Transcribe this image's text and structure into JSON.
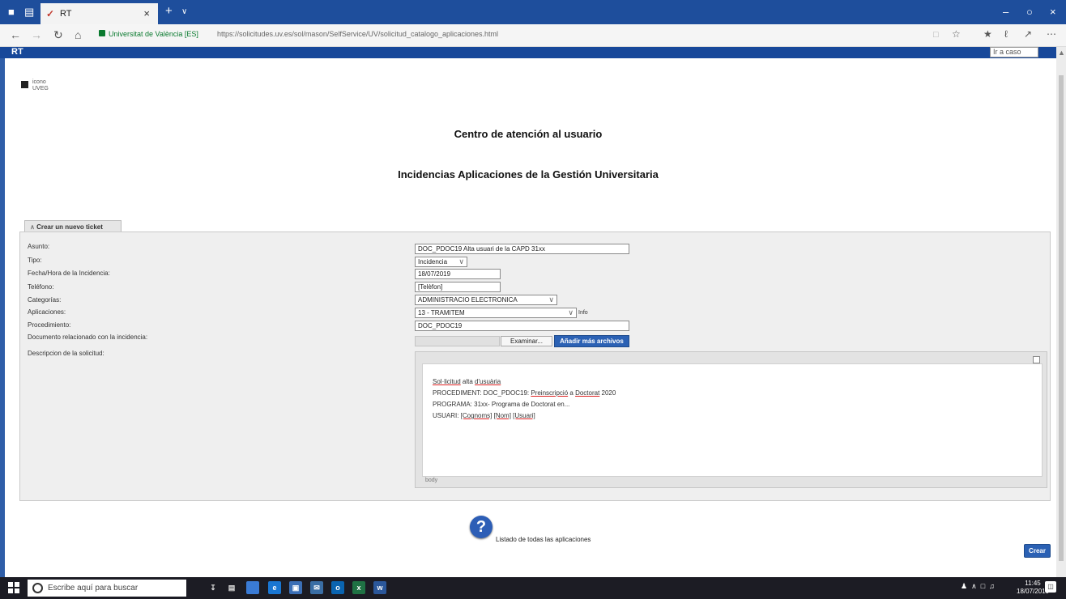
{
  "browser": {
    "tab_title": "RT",
    "site_identity": "Universitat de València [ES]",
    "url": "https://solicitudes.uv.es/sol/mason/SelfService/UV/solicitud_catalogo_aplicaciones.html"
  },
  "header": {
    "app_name": "RT",
    "goto_placeholder": "Ir a caso"
  },
  "logo": {
    "alt": "icono UVEG"
  },
  "page": {
    "title": "Centro de atención al usuario",
    "subtitle": "Incidencias Aplicaciones de la Gestión Universitaria"
  },
  "form": {
    "tab_label": "Crear un nuevo ticket",
    "labels": {
      "asunto": "Asunto:",
      "tipo": "Tipo:",
      "fecha": "Fecha/Hora de la Incidencia:",
      "telefono": "Teléfono:",
      "categorias": "Categorías:",
      "aplicaciones": "Aplicaciones:",
      "procedimiento": "Procedimiento:",
      "documento": "Documento relacionado con la incidencia:",
      "descripcion": "Descripcion de la solicitud:"
    },
    "values": {
      "asunto": "DOC_PDOC19 Alta usuari de la CAPD 31xx",
      "tipo": "Incidencia",
      "fecha": "18/07/2019",
      "telefono": "[Telèfon]",
      "categorias": "ADMINISTRACIO ELECTRONICA",
      "aplicaciones": "13 - TRAMITEM",
      "procedimiento": "DOC_PDOC19"
    },
    "info_label": "Info",
    "browse_button": "Examinar...",
    "add_files_button": "Añadir más archivos",
    "editor_path": "body",
    "editor_lines": {
      "l1a": "Sol·licitud",
      "l1b": " alta ",
      "l1c": "d'usuària",
      "l2a": "PROCEDIMENT: DOC_PDOC19: ",
      "l2b": "Preinscripció",
      "l2c": " a ",
      "l2d": "Doctorat",
      "l2e": " 2020",
      "l3": "PROGRAMA: 31xx- Programa de Doctorat en...",
      "l4a": "USUARI: ",
      "l4b": "[Cognoms]",
      "l4c": " ",
      "l4d": "[Nom]",
      "l4e": " ",
      "l4f": "[Usuari]"
    }
  },
  "footer": {
    "help_link": "Listado de todas las aplicaciones",
    "submit_button": "Crear"
  },
  "taskbar": {
    "search_placeholder": "Escribe aquí para buscar",
    "time": "11:45",
    "date": "18/07/2019"
  },
  "colors": {
    "accent": "#17489a",
    "button": "#2b61b4"
  }
}
